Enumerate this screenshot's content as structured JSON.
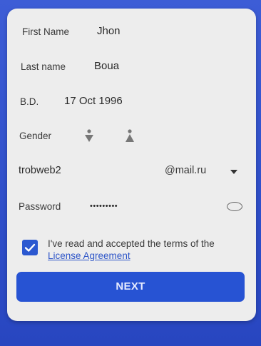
{
  "form": {
    "first_name": {
      "label": "First Name",
      "value": "Jhon"
    },
    "last_name": {
      "label": "Last name",
      "value": "Boua"
    },
    "birth_date": {
      "label": "B.D.",
      "value": "17 Oct 1996"
    },
    "gender": {
      "label": "Gender",
      "options": [
        "male-icon",
        "female-icon"
      ]
    },
    "email": {
      "username": "trobweb2",
      "domain": "@mail.ru"
    },
    "password": {
      "label": "Password",
      "value": "•••••••••"
    }
  },
  "terms": {
    "checked": true,
    "text": "I've read and accepted the terms of the",
    "link": "License Agreement"
  },
  "next_button": {
    "label": "NEXT"
  },
  "colors": {
    "accent": "#2753d3",
    "background": "#3d5dd6",
    "card": "#ededed"
  }
}
